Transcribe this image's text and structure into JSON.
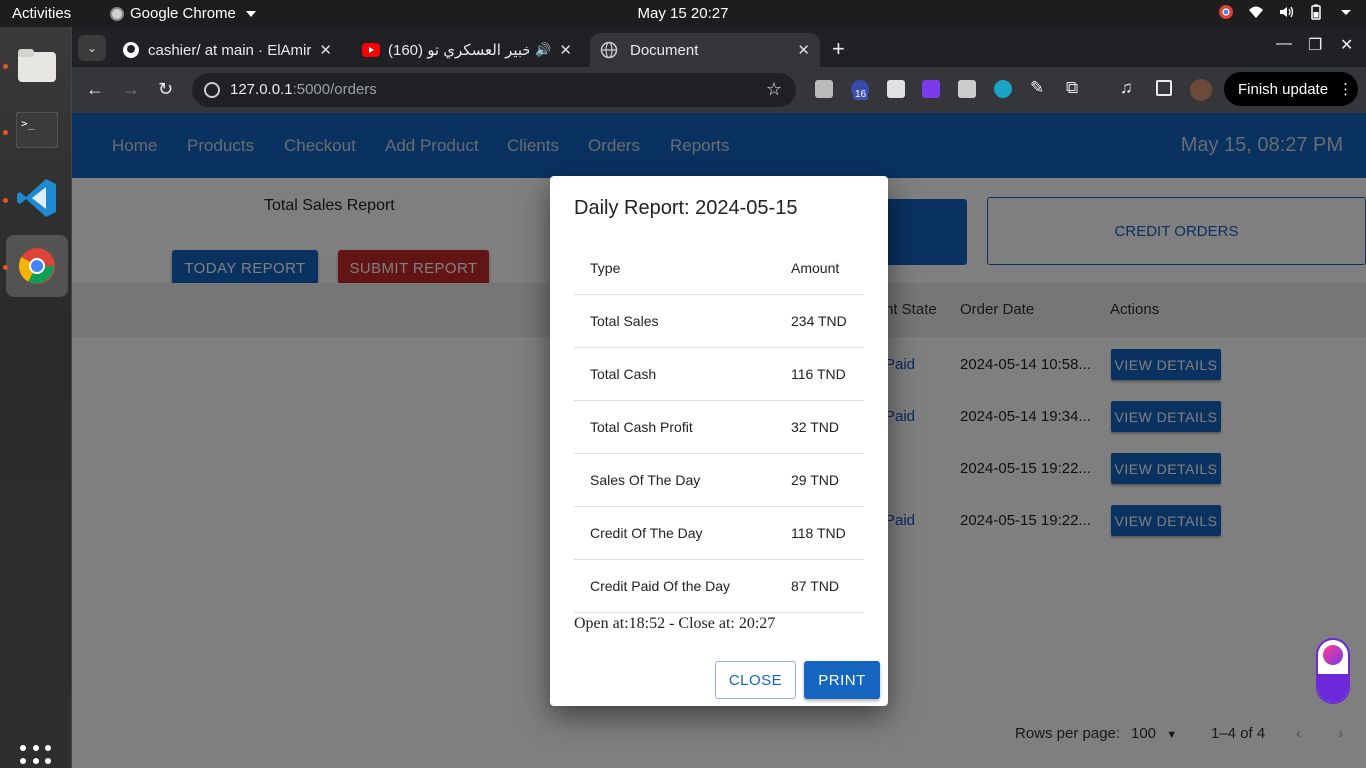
{
  "system": {
    "activities": "Activities",
    "app_name": "Google Chrome",
    "clock": "May 15  20:27"
  },
  "browser": {
    "tabs": [
      {
        "title": "cashier/ at main · ElAmir"
      },
      {
        "title": "(160) الخبير العسكري تو"
      },
      {
        "title": "Document"
      }
    ],
    "url_host": "127.0.0.1",
    "url_path": ":5000/orders",
    "extension_badge": "16",
    "finish_update": "Finish update"
  },
  "app": {
    "nav": [
      "Home",
      "Products",
      "Checkout",
      "Add Product",
      "Clients",
      "Orders",
      "Reports"
    ],
    "datetime": "May 15, 08:27 PM",
    "report_title": "Total Sales Report",
    "today_report_button": "TODAY REPORT",
    "submit_report_button": "SUBMIT REPORT",
    "credit_orders_tab": "CREDIT ORDERS",
    "table": {
      "headers": [
        "nt State",
        "Order Date",
        "Actions"
      ],
      "rows": [
        {
          "state": "Paid",
          "date": "2024-05-14 10:58...",
          "action": "VIEW DETAILS"
        },
        {
          "state": "Paid",
          "date": "2024-05-14 19:34...",
          "action": "VIEW DETAILS"
        },
        {
          "state": "",
          "date": "2024-05-15 19:22...",
          "action": "VIEW DETAILS"
        },
        {
          "state": "Paid",
          "date": "2024-05-15 19:22...",
          "action": "VIEW DETAILS"
        }
      ]
    },
    "pagination": {
      "rows_per_page_label": "Rows per page:",
      "rows_per_page": "100",
      "range": "1–4 of 4"
    }
  },
  "dialog": {
    "title": "Daily Report: 2024-05-15",
    "col_type": "Type",
    "col_amount": "Amount",
    "rows": [
      {
        "type": "Total Sales",
        "amount": "234 TND"
      },
      {
        "type": "Total Cash",
        "amount": "116 TND"
      },
      {
        "type": "Total Cash Profit",
        "amount": "32 TND"
      },
      {
        "type": "Sales Of The Day",
        "amount": "29 TND"
      },
      {
        "type": "Credit Of The Day",
        "amount": "118 TND"
      },
      {
        "type": "Credit Paid Of the Day",
        "amount": "87 TND"
      }
    ],
    "open_close": "Open at:18:52 - Close at: 20:27",
    "close_button": "CLOSE",
    "print_button": "PRINT"
  }
}
